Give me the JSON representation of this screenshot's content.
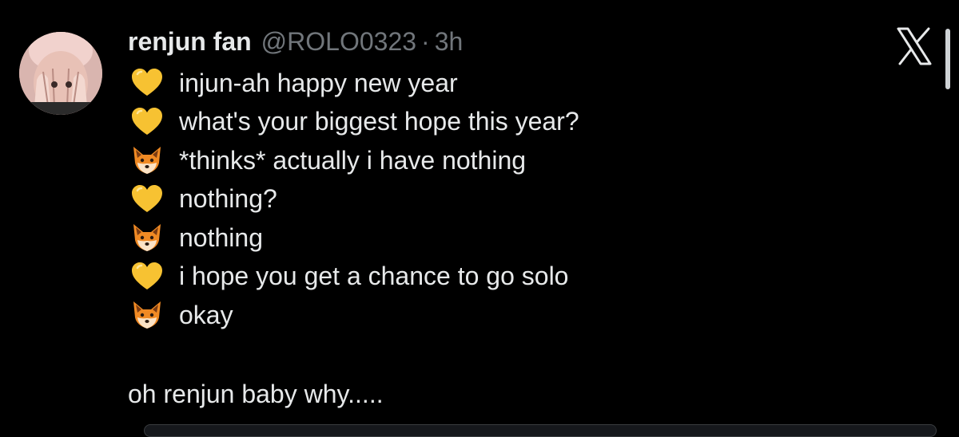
{
  "author": {
    "display_name": "renjun fan",
    "handle": "@ROLO0323",
    "separator": "·",
    "time": "3h"
  },
  "lines": [
    {
      "icon": "yellow-heart-icon",
      "text": "injun-ah happy new year"
    },
    {
      "icon": "yellow-heart-icon",
      "text": "what's your biggest hope this year?"
    },
    {
      "icon": "fox-face-icon",
      "text": "*thinks* actually i have nothing"
    },
    {
      "icon": "yellow-heart-icon",
      "text": "nothing?"
    },
    {
      "icon": "fox-face-icon",
      "text": "nothing"
    },
    {
      "icon": "yellow-heart-icon",
      "text": "i hope you get a chance to go solo"
    },
    {
      "icon": "fox-face-icon",
      "text": "okay"
    }
  ],
  "closing_text": "oh renjun baby why.....",
  "colors": {
    "background": "#000000",
    "text": "#e7e9ea",
    "muted": "#71767b",
    "heart": "#f7c232",
    "fox": "#f08a24"
  }
}
